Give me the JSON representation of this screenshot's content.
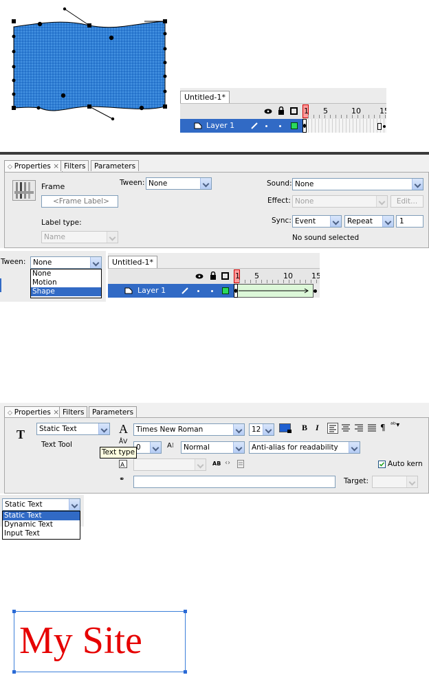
{
  "timeline1": {
    "tab": "Untitled-1*",
    "frame_numbers": [
      "1",
      "5",
      "10",
      "15"
    ],
    "layer": "Layer 1"
  },
  "properties1": {
    "tabs": [
      "Properties",
      "Filters",
      "Parameters"
    ],
    "frame_label": "Frame",
    "frame_input_placeholder": "<Frame Label>",
    "label_type_label": "Label type:",
    "label_type_value": "Name",
    "tween_label": "Tween:",
    "tween_value": "None",
    "sound_label": "Sound:",
    "sound_value": "None",
    "effect_label": "Effect:",
    "effect_value": "None",
    "edit_button": "Edit...",
    "sync_label": "Sync:",
    "sync_value": "Event",
    "repeat_value": "Repeat",
    "repeat_count": "1",
    "status": "No sound selected"
  },
  "tween_dropdown": {
    "label": "Tween:",
    "value": "None",
    "options": [
      "None",
      "Motion",
      "Shape"
    ],
    "selected": "Shape"
  },
  "timeline2": {
    "tab": "Untitled-1*",
    "frame_numbers": [
      "1",
      "5",
      "10",
      "15"
    ],
    "layer": "Layer 1"
  },
  "properties2": {
    "tabs": [
      "Properties",
      "Filters",
      "Parameters"
    ],
    "text_type_value": "Static Text",
    "tool_label": "Text Tool",
    "tooltip": "Text type",
    "font_value": "Times New Roman",
    "font_size": "12",
    "bold_label": "B",
    "italic_label": "I",
    "letter_spacing": "0",
    "position_value": "Normal",
    "antialias_value": "Anti-alias for readability",
    "auto_kern_label": "Auto kern",
    "target_label": "Target:",
    "text_color": "#1f5fd0"
  },
  "text_type_dropdown": {
    "value": "Static Text",
    "options": [
      "Static Text",
      "Dynamic Text",
      "Input Text"
    ],
    "selected": "Static Text"
  },
  "mysite": {
    "text": "My Site",
    "color": "#e60000"
  }
}
